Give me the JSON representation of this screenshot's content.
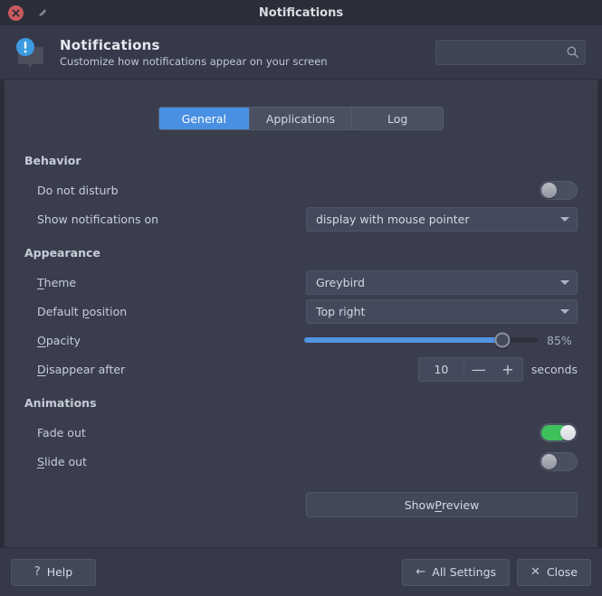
{
  "window": {
    "title": "Notifications",
    "close_icon": "window-close-icon",
    "shade_icon": "window-shade-icon"
  },
  "header": {
    "icon": "notification-bubble-icon",
    "title": "Notifications",
    "subtitle": "Customize how notifications appear on your screen",
    "search": {
      "value": "",
      "placeholder": "",
      "icon": "search-icon"
    }
  },
  "tabs": [
    {
      "label": "General",
      "active": true
    },
    {
      "label": "Applications",
      "active": false
    },
    {
      "label": "Log",
      "active": false
    }
  ],
  "sections": {
    "behavior": {
      "title": "Behavior",
      "do_not_disturb": {
        "label": "Do not disturb",
        "state": "off"
      },
      "show_on": {
        "label": "Show notifications on",
        "value": "display with mouse pointer",
        "arrow_icon": "chevron-down-icon"
      }
    },
    "appearance": {
      "title": "Appearance",
      "theme": {
        "label_pre": "",
        "label_mnemonic": "T",
        "label_post": "heme",
        "value": "Greybird",
        "arrow_icon": "chevron-down-icon"
      },
      "default_position": {
        "label_pre": "Default ",
        "label_mnemonic": "p",
        "label_post": "osition",
        "value": "Top right",
        "arrow_icon": "chevron-down-icon"
      },
      "opacity": {
        "label_pre": "",
        "label_mnemonic": "O",
        "label_post": "pacity",
        "value_text": "85%",
        "percent": 85
      },
      "disappear_after": {
        "label_pre": "",
        "label_mnemonic": "D",
        "label_post": "isappear after",
        "value": "10",
        "minus_label": "—",
        "plus_label": "+",
        "unit": "seconds"
      }
    },
    "animations": {
      "title": "Animations",
      "fade_out": {
        "label": "Fade out",
        "state": "on"
      },
      "slide_out": {
        "label_pre": "",
        "label_mnemonic": "S",
        "label_post": "lide out",
        "state": "off"
      }
    }
  },
  "preview_button": {
    "label_pre": "Show ",
    "label_mnemonic": "P",
    "label_post": "review"
  },
  "footer": {
    "help": {
      "icon": "question-mark-icon",
      "icon_glyph": "?",
      "label": "Help"
    },
    "all_settings": {
      "icon": "arrow-left-icon",
      "icon_glyph": "←",
      "label": "All Settings"
    },
    "close": {
      "icon": "cross-icon",
      "icon_glyph": "✕",
      "label": "Close"
    }
  },
  "colors": {
    "accent": "#4a90e2",
    "slider_fill": "#5294e2",
    "toggle_on": "#3ec05a",
    "window_bg": "#3a3e4c",
    "titlebar_bg": "#2b2e39",
    "close_button": "#cb5a5e"
  }
}
